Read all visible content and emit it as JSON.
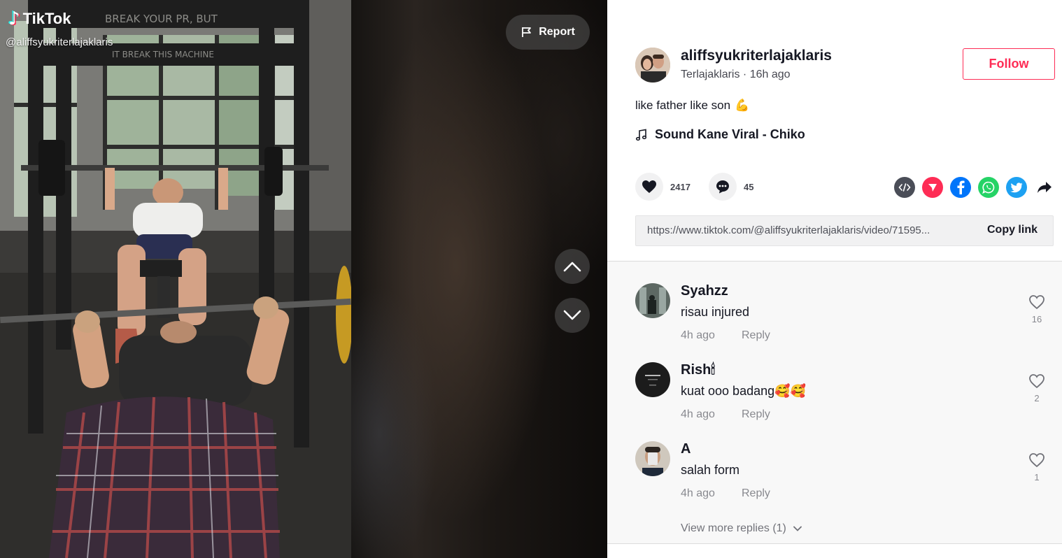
{
  "video": {
    "logo_text": "TikTok",
    "watermark_user": "@aliffsyukriterlajaklaris",
    "report_label": "Report",
    "prev_icon": "chevron-up-icon",
    "next_icon": "chevron-down-icon"
  },
  "author": {
    "username": "aliffsyukriterlajaklaris",
    "subtitle": "Terlajaklaris · 16h ago",
    "follow_label": "Follow"
  },
  "post": {
    "caption": "like father like son",
    "caption_emoji": "💪",
    "music": "Sound Kane Viral - Chiko"
  },
  "stats": {
    "likes": "2417",
    "comments": "45"
  },
  "share_icons": [
    "embed-icon",
    "send-to-friends-icon",
    "facebook-icon",
    "whatsapp-icon",
    "twitter-icon",
    "share-arrow-icon"
  ],
  "link": {
    "url": "https://www.tiktok.com/@aliffsyukriterlajaklaris/video/71595...",
    "copy_label": "Copy link"
  },
  "comments": [
    {
      "user": "Syahzz",
      "text": "risau injured",
      "time": "4h ago",
      "reply": "Reply",
      "likes": "16"
    },
    {
      "user": "Rish🕯",
      "text": "kuat ooo badang🥰🥰",
      "time": "4h ago",
      "reply": "Reply",
      "likes": "2"
    },
    {
      "user": "A",
      "text": "salah form",
      "time": "4h ago",
      "reply": "Reply",
      "likes": "1"
    }
  ],
  "more_replies": "View more replies (1)",
  "colors": {
    "accent": "#fe2c55",
    "text": "#161823",
    "facebook": "#0075fa",
    "whatsapp": "#25d366",
    "twitter": "#1da1f2",
    "send": "#fe2c55",
    "embed": "#4a4d57"
  }
}
